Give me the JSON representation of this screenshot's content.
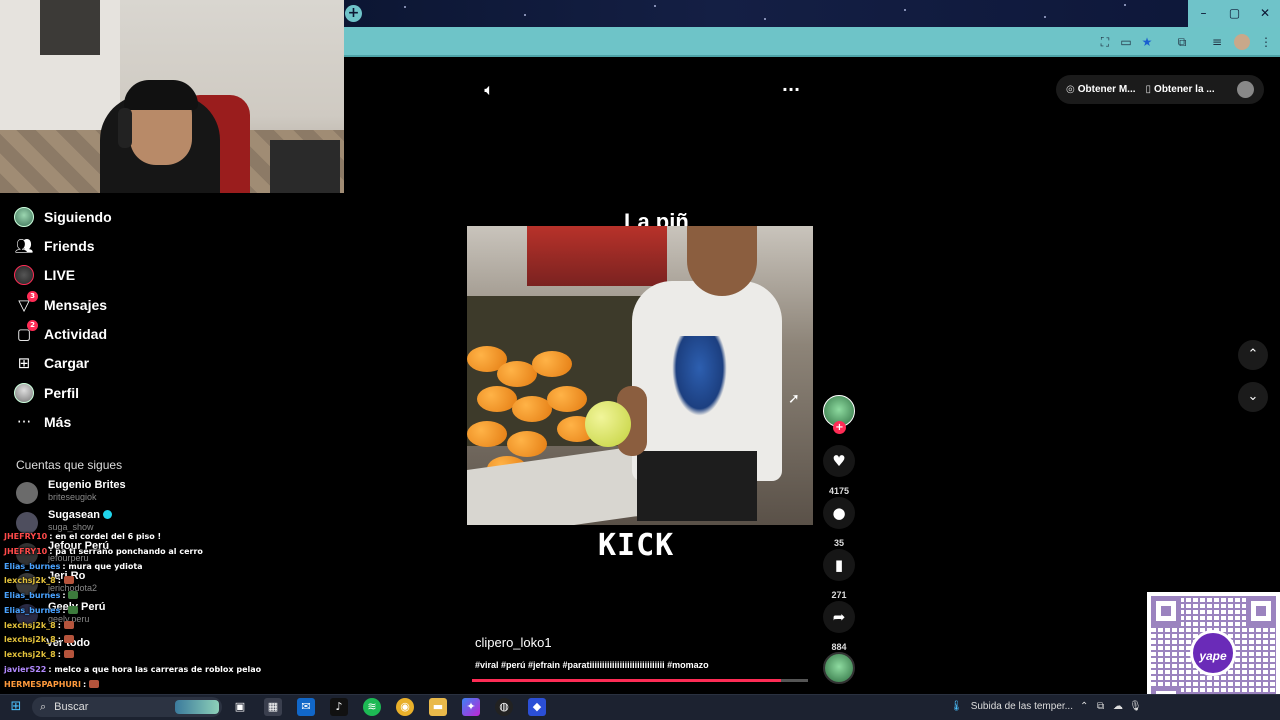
{
  "browser": {
    "new_tab_icon": "plus-icon",
    "window_controls": {
      "minimize": "–",
      "maximize": "▢",
      "close": "✕"
    },
    "toolbar_icons": [
      "translate-icon",
      "cast-icon",
      "bookmark-star-icon",
      "extensions-icon",
      "reading-list-icon",
      "profile-icon",
      "more-icon"
    ],
    "accent_color": "#6ec4c8"
  },
  "sidebar": {
    "items": [
      {
        "label": "Siguiendo",
        "icon": "following-avatar-icon"
      },
      {
        "label": "Friends",
        "icon": "friends-icon"
      },
      {
        "label": "LIVE",
        "icon": "live-icon"
      },
      {
        "label": "Mensajes",
        "icon": "messages-icon",
        "badge": "3"
      },
      {
        "label": "Actividad",
        "icon": "activity-icon",
        "badge": "2"
      },
      {
        "label": "Cargar",
        "icon": "upload-icon"
      },
      {
        "label": "Perfil",
        "icon": "profile-icon"
      },
      {
        "label": "Más",
        "icon": "more-icon"
      }
    ],
    "following_header": "Cuentas que sigues",
    "accounts": [
      {
        "name": "Eugenio Brites",
        "handle": "briteseugiok"
      },
      {
        "name": "Sugasean",
        "handle": "suga_show",
        "verified": true
      },
      {
        "name": "Jefour Perú",
        "handle": "jefourperu"
      },
      {
        "name": "Jeri Ro",
        "handle": "jerichodota2"
      },
      {
        "name": "Geely Perú",
        "handle": "geely.peru"
      },
      {
        "name": "Ver todo",
        "handle": ""
      }
    ]
  },
  "chat": [
    {
      "user": "JHEFRY10",
      "message": ": en el cordel del 6 piso !",
      "color": "#ff4a4a"
    },
    {
      "user": "JHEFRY10",
      "message": ": pa ti serrano ponchando al cerro",
      "color": "#ff4a4a"
    },
    {
      "user": "Elias_burnes",
      "message": ": mura que ydiota",
      "color": "#4aa3ff"
    },
    {
      "user": "lexchsj2k_8",
      "message": ":",
      "color": "#e3c23b"
    },
    {
      "user": "Elias_burnes",
      "message": ":",
      "color": "#4aa3ff"
    },
    {
      "user": "Elias_burnes",
      "message": ":",
      "color": "#4aa3ff"
    },
    {
      "user": "lexchsj2k_8",
      "message": ":",
      "color": "#e3c23b"
    },
    {
      "user": "lexchsj2k_8",
      "message": ":",
      "color": "#e3c23b"
    },
    {
      "user": "lexchsj2k_8",
      "message": ":",
      "color": "#e3c23b"
    },
    {
      "user": "javierS22",
      "message": ": melco a que hora las carreras de roblox pelao",
      "color": "#b38aff"
    },
    {
      "user": "HERMESPAPHURI",
      "message": ":",
      "color": "#ff9a3c"
    }
  ],
  "video": {
    "caption": "La piñ",
    "watermark": "KICK",
    "username": "clipero_loko1",
    "description": "#viral #perú #jefrain #paratiiiiiiiiiiiiiiiiiiiiiiiiiiiiii #momazo",
    "progress_percent": 92,
    "likes": "4175",
    "comments": "35",
    "saves": "271",
    "shares": "884"
  },
  "top_buttons": {
    "get_app_1": "Obtener M...",
    "get_app_2": "Obtener la ..."
  },
  "taskbar": {
    "search_placeholder": "Buscar",
    "weather": "Subida de las temper..."
  }
}
